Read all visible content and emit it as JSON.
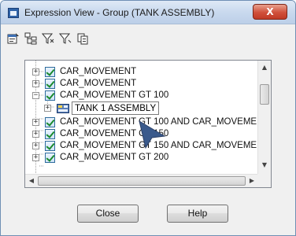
{
  "window": {
    "title": "Expression View - Group (TANK ASSEMBLY)",
    "close_glyph": "X"
  },
  "toolbar": {
    "icons": [
      "properties-icon",
      "expand-tree-icon",
      "filter-icon",
      "filter-clear-icon",
      "copy-icon"
    ]
  },
  "tree": {
    "rows": [
      {
        "label": "CAR_MOVEMENT",
        "expander": "+",
        "checked": true
      },
      {
        "label": "CAR_MOVEMENT",
        "expander": "+",
        "checked": true
      },
      {
        "label": "CAR_MOVEMENT GT 100",
        "expander": "−",
        "checked": true
      },
      {
        "label": "TANK 1 ASSEMBLY",
        "expander": "+",
        "icon": "assembly-icon"
      },
      {
        "label": "CAR_MOVEMENT GT 100 AND CAR_MOVEME",
        "expander": "+",
        "checked": true
      },
      {
        "label": "CAR_MOVEMENT GT 150",
        "expander": "+",
        "checked": true
      },
      {
        "label": "CAR_MOVEMENT GT 150 AND CAR_MOVEME",
        "expander": "+",
        "checked": true
      },
      {
        "label": "CAR_MOVEMENT GT 200",
        "expander": "+",
        "checked": true
      }
    ]
  },
  "buttons": {
    "close_label": "Close",
    "help_label": "Help"
  },
  "colors": {
    "titlebar": "#c9d9ee",
    "close_button": "#d0503b",
    "check": "#1a8a2d",
    "pointer": "#3a5a8c"
  }
}
